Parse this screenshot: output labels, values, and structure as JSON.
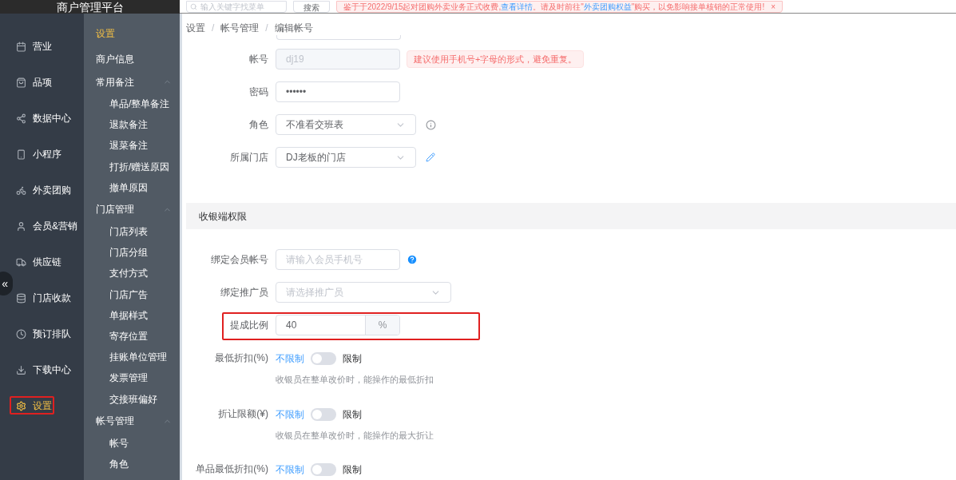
{
  "header": {
    "title": "商户管理平台",
    "search": {
      "placeholder": "输入关键字找菜单",
      "button": "搜索"
    },
    "notice": {
      "parts": [
        {
          "kind": "text",
          "text": "鉴于于2022/9/15起对团购外卖业务正式收费,"
        },
        {
          "kind": "link",
          "text": "查看详情"
        },
        {
          "kind": "text",
          "text": "。请及时前往\""
        },
        {
          "kind": "link",
          "text": "外卖团购权益"
        },
        {
          "kind": "text",
          "text": "\"购买，以免影响接单核销的正常使用!"
        }
      ],
      "close": "×"
    }
  },
  "sidebar": {
    "items": [
      {
        "label": "营业",
        "selected": false
      },
      {
        "label": "品项",
        "selected": false
      },
      {
        "label": "数据中心",
        "selected": false
      },
      {
        "label": "小程序",
        "selected": false
      },
      {
        "label": "外卖团购",
        "selected": false
      },
      {
        "label": "会员&营销",
        "selected": false
      },
      {
        "label": "供应链",
        "selected": false
      },
      {
        "label": "门店收款",
        "selected": false
      },
      {
        "label": "预订排队",
        "selected": false
      },
      {
        "label": "下载中心",
        "selected": false
      },
      {
        "label": "设置",
        "selected": true
      }
    ],
    "collapse_button": "«"
  },
  "submenu": {
    "title": "设置",
    "items": [
      {
        "label": "商户信息"
      },
      {
        "label": "常用备注",
        "expanded": true,
        "children": [
          {
            "label": "单品/整单备注"
          },
          {
            "label": "退款备注"
          },
          {
            "label": "退菜备注"
          },
          {
            "label": "打折/赠送原因"
          },
          {
            "label": "撤单原因"
          }
        ]
      },
      {
        "label": "门店管理",
        "expanded": true,
        "children": [
          {
            "label": "门店列表"
          },
          {
            "label": "门店分组"
          },
          {
            "label": "支付方式"
          },
          {
            "label": "门店广告"
          },
          {
            "label": "单据样式"
          },
          {
            "label": "寄存位置"
          },
          {
            "label": "挂账单位管理"
          },
          {
            "label": "发票管理"
          },
          {
            "label": "交接班偏好"
          }
        ]
      },
      {
        "label": "帐号管理",
        "expanded": true,
        "children": [
          {
            "label": "帐号"
          },
          {
            "label": "角色"
          }
        ]
      }
    ]
  },
  "breadcrumb": {
    "items": [
      "设置",
      "帐号管理",
      "编辑帐号"
    ],
    "separators": [
      "/",
      "/"
    ]
  },
  "form": [
    {
      "kind": "input",
      "label": "帐号",
      "value": "dj19",
      "disabled": true,
      "tip": "建议使用手机号+字母的形式，避免重复。"
    },
    {
      "kind": "input",
      "label": "密码",
      "value": "••••••",
      "disabled": false
    },
    {
      "kind": "select",
      "label": "角色",
      "value": "不准看交班表"
    },
    {
      "kind": "select",
      "label": "所属门店",
      "value": "DJ老板的门店"
    }
  ],
  "section": {
    "title": "收银端权限",
    "fields": [
      {
        "kind": "input",
        "label": "绑定会员帐号",
        "placeholder": "请输入会员手机号"
      },
      {
        "kind": "select",
        "label": "绑定推广员",
        "placeholder": "请选择推广员"
      },
      {
        "kind": "suffix",
        "label": "提成比例",
        "value": "40",
        "suffix": "%"
      },
      {
        "kind": "switch",
        "label": "最低折扣(%)",
        "off_label": "不限制",
        "on_label": "限制",
        "on": false,
        "hint": "收银员在整单改价时，能操作的最低折扣"
      },
      {
        "kind": "switch",
        "label": "折让限额(¥)",
        "off_label": "不限制",
        "on_label": "限制",
        "on": false,
        "hint": "收银员在整单改价时，能操作的最大折让"
      },
      {
        "kind": "switch",
        "label": "单品最低折扣(%)",
        "off_label": "不限制",
        "on_label": "限制",
        "on": false
      }
    ]
  }
}
